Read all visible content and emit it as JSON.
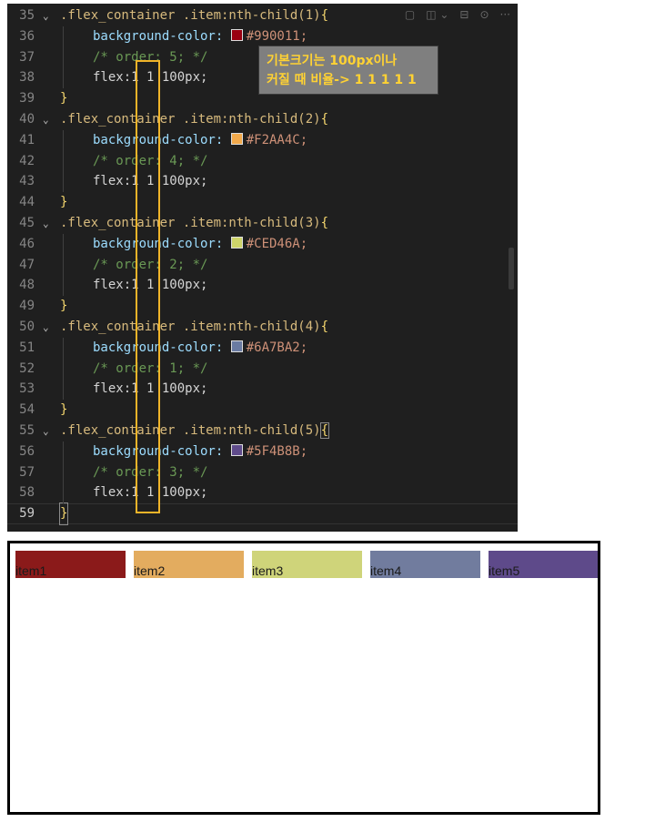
{
  "editor": {
    "toolbar_icons": [
      "comment-icon",
      "split-editor-icon",
      "chevron-down-icon",
      "layout-icon",
      "settings-icon",
      "more-icon"
    ],
    "lines": [
      {
        "n": "35",
        "kind": "selector",
        "selector": ".flex_container .item:nth-child(1)",
        "open": "{"
      },
      {
        "n": "36",
        "kind": "bg",
        "prop": "background-color:",
        "swatch": "#990011",
        "value": "#990011;"
      },
      {
        "n": "37",
        "kind": "comment",
        "text": "/* order: 5; */"
      },
      {
        "n": "38",
        "kind": "flex",
        "prop": "flex:",
        "value": "1 1 100px;"
      },
      {
        "n": "39",
        "kind": "close",
        "close": "}"
      },
      {
        "n": "40",
        "kind": "selector",
        "selector": ".flex_container .item:nth-child(2)",
        "open": "{"
      },
      {
        "n": "41",
        "kind": "bg",
        "prop": "background-color:",
        "swatch": "#F2AA4C",
        "value": "#F2AA4C;"
      },
      {
        "n": "42",
        "kind": "comment",
        "text": "/* order: 4; */"
      },
      {
        "n": "43",
        "kind": "flex",
        "prop": "flex:",
        "value": "1 1 100px;"
      },
      {
        "n": "44",
        "kind": "close",
        "close": "}"
      },
      {
        "n": "45",
        "kind": "selector",
        "selector": ".flex_container .item:nth-child(3)",
        "open": "{"
      },
      {
        "n": "46",
        "kind": "bg",
        "prop": "background-color:",
        "swatch": "#CED46A",
        "value": "#CED46A;"
      },
      {
        "n": "47",
        "kind": "comment",
        "text": "/* order: 2; */"
      },
      {
        "n": "48",
        "kind": "flex",
        "prop": "flex:",
        "value": "1 1 100px;"
      },
      {
        "n": "49",
        "kind": "close",
        "close": "}"
      },
      {
        "n": "50",
        "kind": "selector",
        "selector": ".flex_container .item:nth-child(4)",
        "open": "{"
      },
      {
        "n": "51",
        "kind": "bg",
        "prop": "background-color:",
        "swatch": "#6A7BA2",
        "value": "#6A7BA2;"
      },
      {
        "n": "52",
        "kind": "comment",
        "text": "/* order: 1; */"
      },
      {
        "n": "53",
        "kind": "flex",
        "prop": "flex:",
        "value": "1 1 100px;"
      },
      {
        "n": "54",
        "kind": "close",
        "close": "}"
      },
      {
        "n": "55",
        "kind": "selector",
        "selector": ".flex_container .item:nth-child(5)",
        "open": "{"
      },
      {
        "n": "56",
        "kind": "bg",
        "prop": "background-color:",
        "swatch": "#5F4B8B",
        "value": "#5F4B8B;"
      },
      {
        "n": "57",
        "kind": "comment",
        "text": "/* order: 3; */"
      },
      {
        "n": "58",
        "kind": "flex",
        "prop": "flex:",
        "value": "1 1 100px;"
      },
      {
        "n": "59",
        "kind": "close",
        "close": "}"
      }
    ]
  },
  "tooltip": {
    "line1": "기본크기는 100px이나",
    "line2": "커질 때 비율-> 1 1 1 1 1",
    "color": "#ffd233"
  },
  "render": {
    "items": [
      {
        "label": "item1",
        "color": "#8b1a1a"
      },
      {
        "label": "item2",
        "color": "#e3ac5f"
      },
      {
        "label": "item3",
        "color": "#cfd47a"
      },
      {
        "label": "item4",
        "color": "#717c9e"
      },
      {
        "label": "item5",
        "color": "#5e4a8a"
      }
    ]
  }
}
